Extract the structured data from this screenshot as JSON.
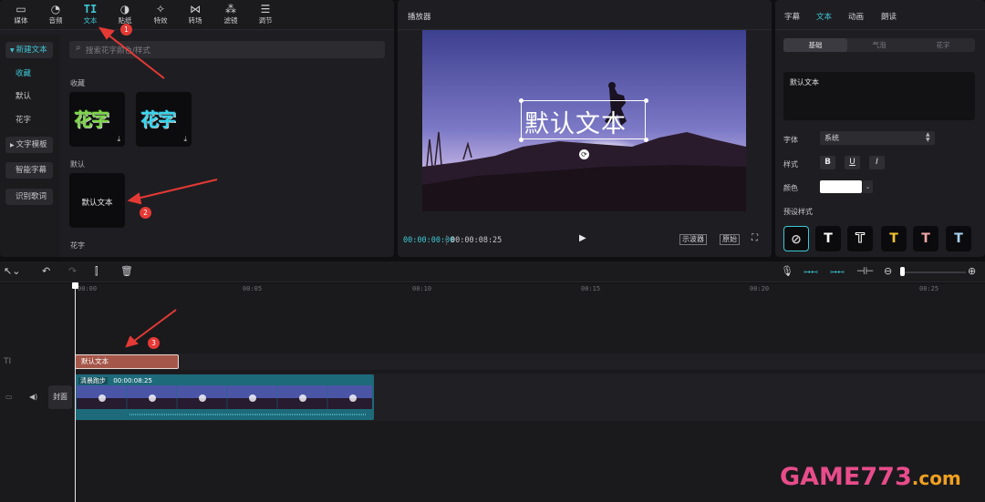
{
  "topnav": {
    "items": [
      {
        "label": "媒体",
        "icon": "media-icon",
        "glyph": "▭"
      },
      {
        "label": "音频",
        "icon": "audio-icon",
        "glyph": "◔"
      },
      {
        "label": "文本",
        "icon": "text-icon",
        "glyph": "TI"
      },
      {
        "label": "贴纸",
        "icon": "sticker-icon",
        "glyph": "◑"
      },
      {
        "label": "特效",
        "icon": "effects-icon",
        "glyph": "✧"
      },
      {
        "label": "转场",
        "icon": "transition-icon",
        "glyph": "⋈"
      },
      {
        "label": "滤镜",
        "icon": "filter-icon",
        "glyph": "⁂"
      },
      {
        "label": "调节",
        "icon": "adjust-icon",
        "glyph": "☰"
      }
    ],
    "active": "文本"
  },
  "sidebar": {
    "items": [
      {
        "label": "新建文本"
      },
      {
        "label": "收藏"
      },
      {
        "label": "默认"
      },
      {
        "label": "花字"
      },
      {
        "label": "文字模板"
      },
      {
        "label": "智能字幕"
      },
      {
        "label": "识别歌词"
      }
    ]
  },
  "search": {
    "placeholder": "搜索花字颜色/样式"
  },
  "library": {
    "favorites_label": "收藏",
    "default_label": "默认",
    "huazi_label": "花字",
    "favorite_items": [
      {
        "text": "花字"
      },
      {
        "text": "花字"
      }
    ],
    "default_item": "默认文本"
  },
  "player": {
    "title": "播放器",
    "overlay_text": "默认文本",
    "current_time": "00:00:00:00",
    "total_time": "00:00:08:25",
    "btn_scope": "示波器",
    "btn_original": "原始"
  },
  "props": {
    "tabs": [
      "字幕",
      "文本",
      "动画",
      "朗读"
    ],
    "active_tab": "文本",
    "subtabs": [
      "基础",
      "气泡",
      "花字"
    ],
    "text_value": "默认文本",
    "font_label": "字体",
    "font_value": "系统",
    "style_label": "样式",
    "style_buttons": [
      "B",
      "U",
      "I"
    ],
    "color_label": "颜色",
    "color_value": "#ffffff",
    "preset_label": "预设样式",
    "presets": [
      {
        "glyph": "⊘",
        "color": "#cfcfd3"
      },
      {
        "glyph": "T",
        "color": "#ffffff"
      },
      {
        "glyph": "T",
        "color": "#ffffff"
      },
      {
        "glyph": "T",
        "color": "#f2c230"
      },
      {
        "glyph": "T",
        "color": "#f4a7a7"
      },
      {
        "glyph": "T",
        "color": "#a9d3f4"
      }
    ]
  },
  "timeline": {
    "ruler": [
      "00:00",
      "00:05",
      "00:10",
      "00:15",
      "00:20",
      "00:25"
    ],
    "text_clip": "默认文本",
    "video_clip_name": "清晨跑步",
    "video_clip_duration": "00:00:08:25",
    "cover_label": "封面"
  },
  "annotations": {
    "badges": [
      "1",
      "2",
      "3"
    ]
  },
  "watermark": {
    "text": "GAME773",
    "suffix": ".com"
  },
  "colors": {
    "accent": "#3ec8d6",
    "arrow": "#e53935",
    "text_clip": "#a5574a",
    "video_clip": "#1d6a7a"
  }
}
